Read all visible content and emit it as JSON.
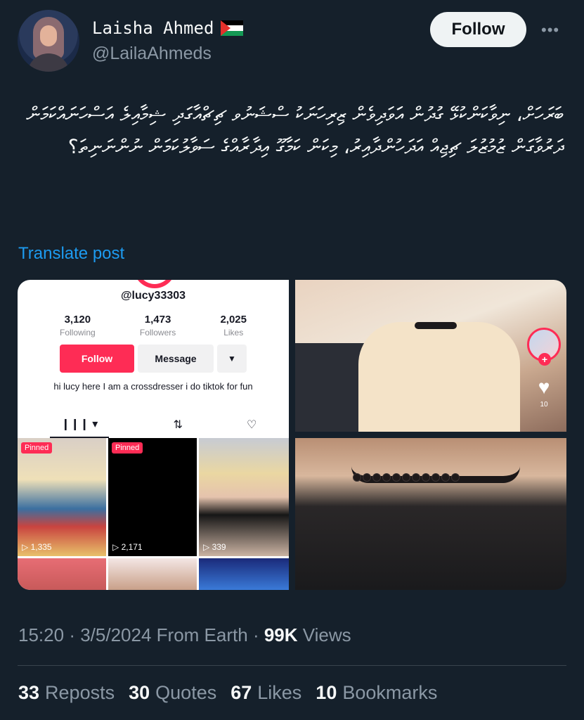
{
  "author": {
    "name": "Laisha Ahmed",
    "handle": "@LailaAhmeds",
    "follow_label": "Follow",
    "more_label": "•••"
  },
  "tweet": {
    "text": "ބަރަހަށް، ނިވާކަންކުޅޭ ގުދުން އަަވަދިވެން ޒިރިހަނަކު ސްޝަނުވ ޗިޗްއާގަދި ޝިމާއިލެ އަސްހަނައްކަމަން ދަރުވާގަން ޒުމުޒުލަ ޗިޖިއް އަދަހުންދާއިރު، މިކަން ކަމާގޫ އިދާރާއްގެ ސަވާލުކަމަން ނުންނަނިތަ؟",
    "translate_label": "Translate post",
    "time": "15:20",
    "date": "3/5/2024",
    "source": "From Earth",
    "views_count": "99K",
    "views_label": "Views",
    "sep": "·"
  },
  "embed": {
    "tiktok_handle": "@lucy33303",
    "stats": [
      {
        "num": "3,120",
        "label": "Following"
      },
      {
        "num": "1,473",
        "label": "Followers"
      },
      {
        "num": "2,025",
        "label": "Likes"
      }
    ],
    "follow_btn": "Follow",
    "message_btn": "Message",
    "dropdown_icon": "▼",
    "bio": "hi lucy here I am a crossdresser i do tiktok for fun",
    "tab_videos_icon": "❙❙❙ ▾",
    "tab_reposts_icon": "⇅",
    "tab_liked_icon": "♡",
    "pinned_label": "Pinned",
    "videos": [
      {
        "views": "▷ 1,335"
      },
      {
        "views": "▷ 2,171"
      },
      {
        "views": "▷ 339"
      }
    ],
    "like_icon": "♥",
    "like_count": "10",
    "plus": "+"
  },
  "engagement": {
    "reposts_count": "33",
    "reposts_label": "Reposts",
    "quotes_count": "30",
    "quotes_label": "Quotes",
    "likes_count": "67",
    "likes_label": "Likes",
    "bookmarks_count": "10",
    "bookmarks_label": "Bookmarks"
  },
  "colors": {
    "background": "#15202b",
    "link": "#1d9bf0",
    "tiktok_pink": "#fe2c55"
  }
}
